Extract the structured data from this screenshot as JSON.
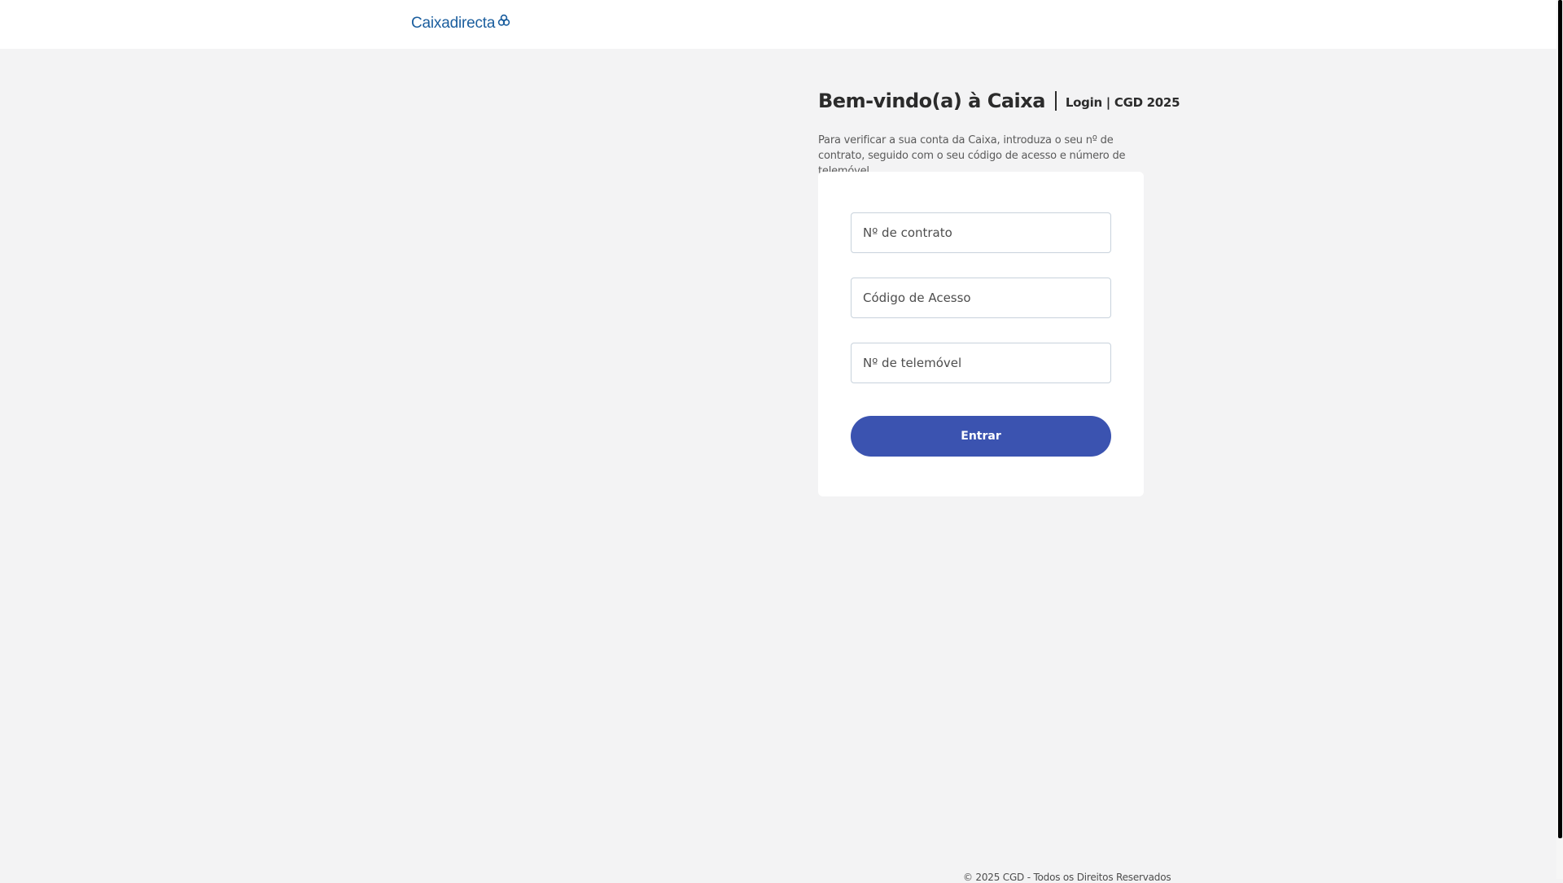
{
  "header": {
    "logo_text": "Caixadirecta",
    "logo_icon": "cgd-symbol-icon",
    "brand_color": "#1b5e9e"
  },
  "login": {
    "title": "Bem-vindo(a) à Caixa",
    "subtitle": "Login | CGD 2025",
    "intro": "Para verificar a sua conta da Caixa, introduza o seu nº de contrato, seguido com o seu código de acesso e número de telemóvel.",
    "fields": {
      "contract_placeholder": "Nº de contrato",
      "access_code_placeholder": "Código de Acesso",
      "phone_placeholder": "Nº de telemóvel"
    },
    "submit_label": "Entrar",
    "button_color": "#3b53b0"
  },
  "footer": {
    "copyright": "© 2025 CGD - Todos os Direitos Reservados"
  }
}
